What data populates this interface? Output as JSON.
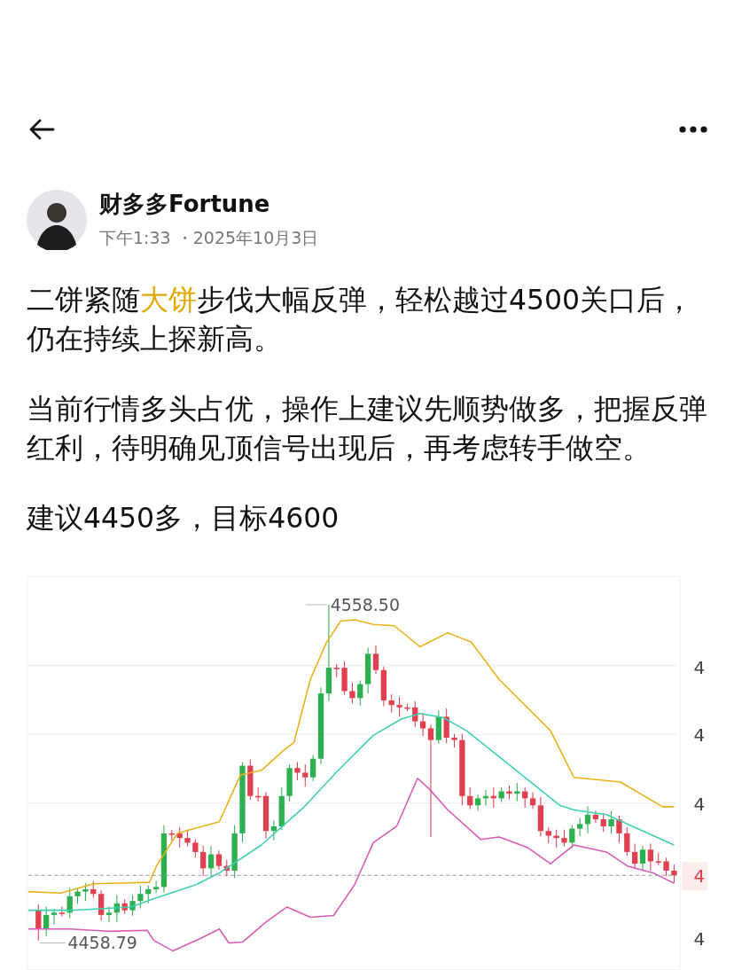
{
  "author": {
    "name": "财多多Fortune",
    "meta": "下午1:33 ・2025年10月3日"
  },
  "paragraphs": [
    {
      "segments": [
        {
          "text": "二饼紧随",
          "highlighted": false
        },
        {
          "text": "大饼",
          "highlighted": true
        },
        {
          "text": "步伐大幅反弹，轻松越过4500关口后，仍在持续上探新高。",
          "highlighted": false
        }
      ]
    },
    {
      "segments": [
        {
          "text": "当前行情多头占优，操作上建议先顺势做多，把握反弹红利，待明确见顶信号出现后，再考虑转手做空。",
          "highlighted": false
        }
      ]
    },
    {
      "segments": [
        {
          "text": "建议4450多，目标4600",
          "highlighted": false
        }
      ]
    }
  ],
  "chart": {
    "high_label": "4558.50",
    "low_label": "4458.79",
    "axis_labels": [
      {
        "text": "4",
        "highlighted": false
      },
      {
        "text": "4",
        "highlighted": false
      },
      {
        "text": "4",
        "highlighted": false
      },
      {
        "text": "4",
        "highlighted": true
      },
      {
        "text": "4",
        "highlighted": false
      }
    ]
  }
}
